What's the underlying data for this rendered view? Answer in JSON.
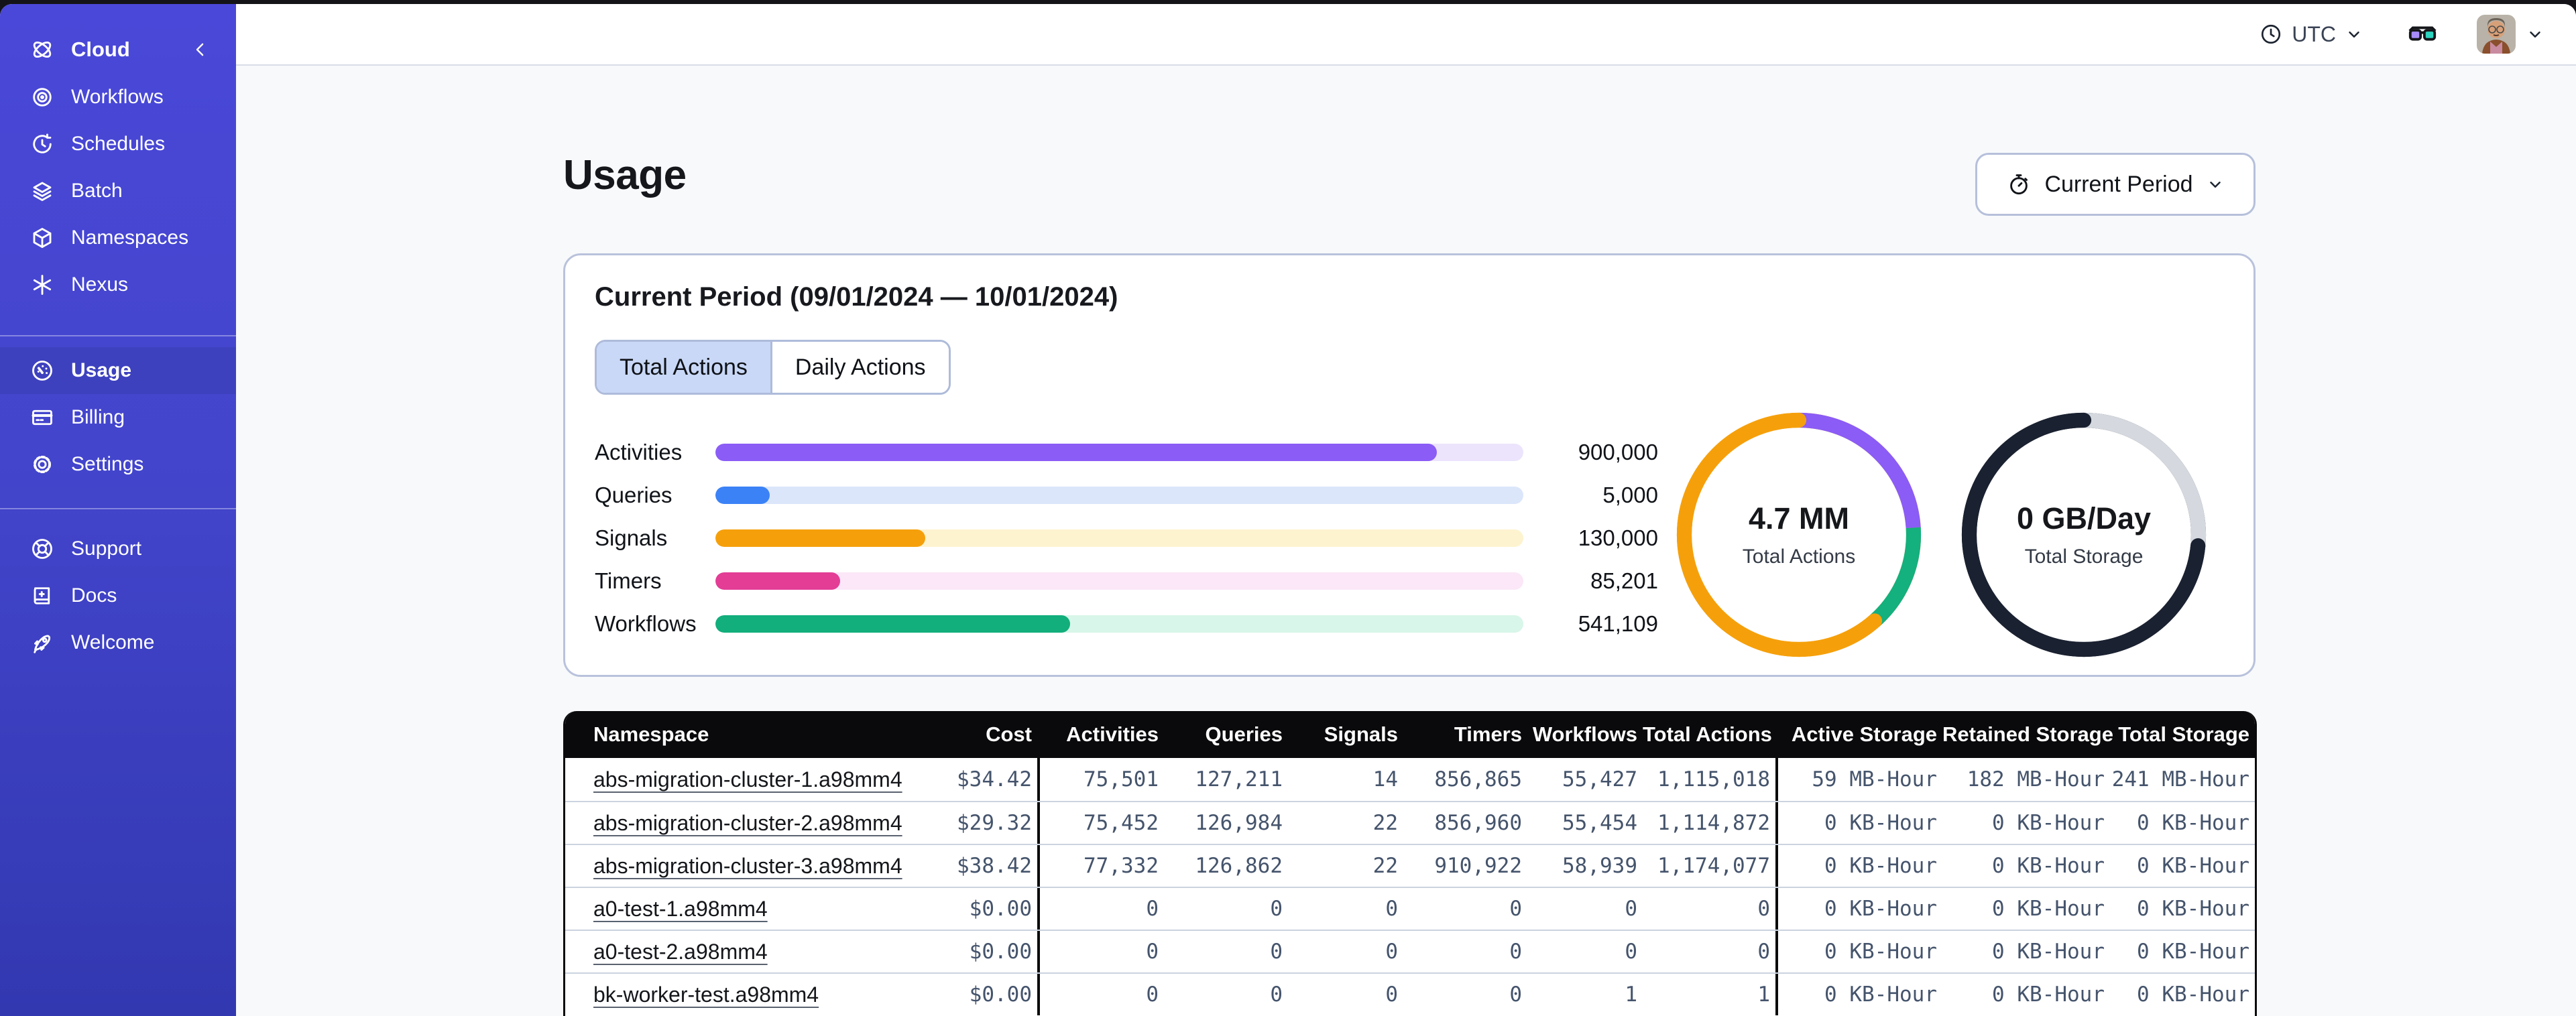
{
  "theme": {
    "sidebar_indigo": "#4445CE",
    "sidebar_selected": "#3E41BE",
    "tab_active_bg": "#C9D8F6",
    "table_header_bg": "#0A0A0C",
    "content_bg": "#F7F9FB"
  },
  "topbar": {
    "timezone_label": "UTC",
    "icon_names": [
      "clock-icon",
      "chevron-down-icon",
      "glasses-icon",
      "user-avatar",
      "chevron-down-icon"
    ]
  },
  "sidebar": {
    "brand": {
      "label": "Cloud",
      "icon": "temporal-logo-icon",
      "collapse_icon": "chevron-left-icon"
    },
    "nav_top": [
      {
        "id": "workflows",
        "label": "Workflows",
        "icon": "workflows-icon"
      },
      {
        "id": "schedules",
        "label": "Schedules",
        "icon": "schedules-icon"
      },
      {
        "id": "batch",
        "label": "Batch",
        "icon": "batch-icon"
      },
      {
        "id": "namespaces",
        "label": "Namespaces",
        "icon": "namespaces-icon"
      },
      {
        "id": "nexus",
        "label": "Nexus",
        "icon": "nexus-icon"
      }
    ],
    "nav_account": [
      {
        "id": "usage",
        "label": "Usage",
        "icon": "gauge-icon",
        "selected": true
      },
      {
        "id": "billing",
        "label": "Billing",
        "icon": "credit-card-icon"
      },
      {
        "id": "settings",
        "label": "Settings",
        "icon": "gear-icon"
      }
    ],
    "nav_footer": [
      {
        "id": "support",
        "label": "Support",
        "icon": "lifebuoy-icon"
      },
      {
        "id": "docs",
        "label": "Docs",
        "icon": "book-icon"
      },
      {
        "id": "welcome",
        "label": "Welcome",
        "icon": "rocket-icon"
      }
    ]
  },
  "page": {
    "title": "Usage",
    "period_selector": {
      "label": "Current Period",
      "icon": "stopwatch-icon",
      "caret": "chevron-down-icon"
    }
  },
  "usage_card": {
    "title": "Current Period (09/01/2024 — 10/01/2024)",
    "tabs": [
      {
        "label": "Total Actions",
        "active": true
      },
      {
        "label": "Daily Actions",
        "active": false
      }
    ]
  },
  "chart_data": [
    {
      "type": "bar",
      "orientation": "horizontal",
      "title": "Actions by type (current period)",
      "categories": [
        "Activities",
        "Queries",
        "Signals",
        "Timers",
        "Workflows"
      ],
      "values": [
        900000,
        5000,
        130000,
        85201,
        541109
      ],
      "value_labels": [
        "900,000",
        "5,000",
        "130,000",
        "85,201",
        "541,109"
      ],
      "fill_percent": [
        89.3,
        6.7,
        26.0,
        15.4,
        43.9
      ],
      "colors": [
        "#8B5CF6",
        "#3B82F6",
        "#F5A00B",
        "#E33D96",
        "#12AE7C"
      ],
      "track_colors": [
        "#ECE4FC",
        "#DBE6FB",
        "#FDF3CF",
        "#FBE7F8",
        "#D8F6E9"
      ],
      "grid": false,
      "legend": "none"
    },
    {
      "type": "pie",
      "variant": "donut",
      "center_label": "4.7 MM",
      "center_sublabel": "Total Actions",
      "segments": [
        {
          "name": "activities-purple",
          "color": "#8B5CF6",
          "percent": 24
        },
        {
          "name": "workflows-green",
          "color": "#14B07E",
          "percent": 14.5
        },
        {
          "name": "signals-orange",
          "color": "#F5A00B",
          "percent": 61.5
        }
      ],
      "start": "top",
      "direction": "clockwise"
    },
    {
      "type": "pie",
      "variant": "donut",
      "center_label": "0 GB/Day",
      "center_sublabel": "Total Storage",
      "segments": [
        {
          "name": "remaining-gray",
          "color": "#D5D9DF",
          "percent": 26.5
        },
        {
          "name": "storage-dark",
          "color": "#1A2130",
          "percent": 73.5
        }
      ],
      "start": "top",
      "direction": "clockwise"
    }
  ],
  "table": {
    "columns": [
      "Namespace",
      "Cost",
      "Activities",
      "Queries",
      "Signals",
      "Timers",
      "Workflows",
      "Total Actions",
      "Active Storage",
      "Retained Storage",
      "Total Storage"
    ],
    "group_separators_after": [
      "Cost",
      "Total Actions"
    ],
    "rows": [
      {
        "namespace": "abs-migration-cluster-1.a98mm4",
        "cost": "$34.42",
        "activities": "75,501",
        "queries": "127,211",
        "signals": "14",
        "timers": "856,865",
        "workflows": "55,427",
        "total_actions": "1,115,018",
        "active_storage": "59 MB-Hour",
        "retained_storage": "182 MB-Hour",
        "total_storage": "241 MB-Hour"
      },
      {
        "namespace": "abs-migration-cluster-2.a98mm4",
        "cost": "$29.32",
        "activities": "75,452",
        "queries": "126,984",
        "signals": "22",
        "timers": "856,960",
        "workflows": "55,454",
        "total_actions": "1,114,872",
        "active_storage": "0 KB-Hour",
        "retained_storage": "0 KB-Hour",
        "total_storage": "0 KB-Hour"
      },
      {
        "namespace": "abs-migration-cluster-3.a98mm4",
        "cost": "$38.42",
        "activities": "77,332",
        "queries": "126,862",
        "signals": "22",
        "timers": "910,922",
        "workflows": "58,939",
        "total_actions": "1,174,077",
        "active_storage": "0 KB-Hour",
        "retained_storage": "0 KB-Hour",
        "total_storage": "0 KB-Hour"
      },
      {
        "namespace": "a0-test-1.a98mm4",
        "cost": "$0.00",
        "activities": "0",
        "queries": "0",
        "signals": "0",
        "timers": "0",
        "workflows": "0",
        "total_actions": "0",
        "active_storage": "0 KB-Hour",
        "retained_storage": "0 KB-Hour",
        "total_storage": "0 KB-Hour"
      },
      {
        "namespace": "a0-test-2.a98mm4",
        "cost": "$0.00",
        "activities": "0",
        "queries": "0",
        "signals": "0",
        "timers": "0",
        "workflows": "0",
        "total_actions": "0",
        "active_storage": "0 KB-Hour",
        "retained_storage": "0 KB-Hour",
        "total_storage": "0 KB-Hour"
      },
      {
        "namespace": "bk-worker-test.a98mm4",
        "cost": "$0.00",
        "activities": "0",
        "queries": "0",
        "signals": "0",
        "timers": "0",
        "workflows": "1",
        "total_actions": "1",
        "active_storage": "0 KB-Hour",
        "retained_storage": "0 KB-Hour",
        "total_storage": "0 KB-Hour"
      }
    ]
  }
}
